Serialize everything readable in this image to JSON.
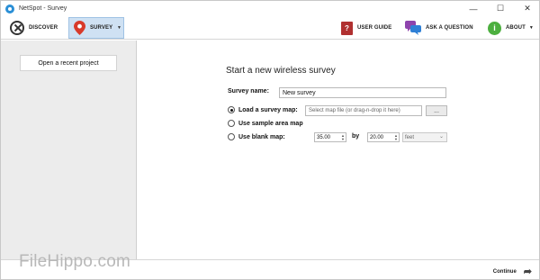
{
  "window": {
    "title": "NetSpot - Survey",
    "controls": {
      "minimize": "—",
      "maximize": "☐",
      "close": "✕"
    }
  },
  "toolbar": {
    "discover_label": "DISCOVER",
    "survey_label": "SURVEY",
    "user_guide_label": "USER GUIDE",
    "ask_label": "ASK A QUESTION",
    "about_label": "ABOUT",
    "icons": [
      "discover-icon",
      "location-pin-icon",
      "book-icon",
      "chat-bubbles-icon",
      "info-icon"
    ]
  },
  "sidebar": {
    "recent_button": "Open a recent project"
  },
  "main": {
    "heading": "Start a new wireless survey",
    "survey_name_label": "Survey name:",
    "survey_name_value": "New survey",
    "load_map_label": "Load a survey map:",
    "map_file_placeholder": "Select map file (or drag-n-drop it here)",
    "browse_label": "...",
    "sample_label": "Use sample area map",
    "blank_label": "Use blank map:",
    "width_value": "35.00",
    "by_label": "by",
    "height_value": "20.00",
    "unit_value": "feet",
    "selected_option": "load_map"
  },
  "footer": {
    "continue_label": "Continue"
  },
  "watermark": "FileHippo.com",
  "colors": {
    "survey_tab_bg": "#cfe1f3",
    "sidebar_bg": "#ececec",
    "pin_red": "#d83a2b",
    "info_green": "#4caf3f",
    "app_blue": "#2a8fd6"
  }
}
